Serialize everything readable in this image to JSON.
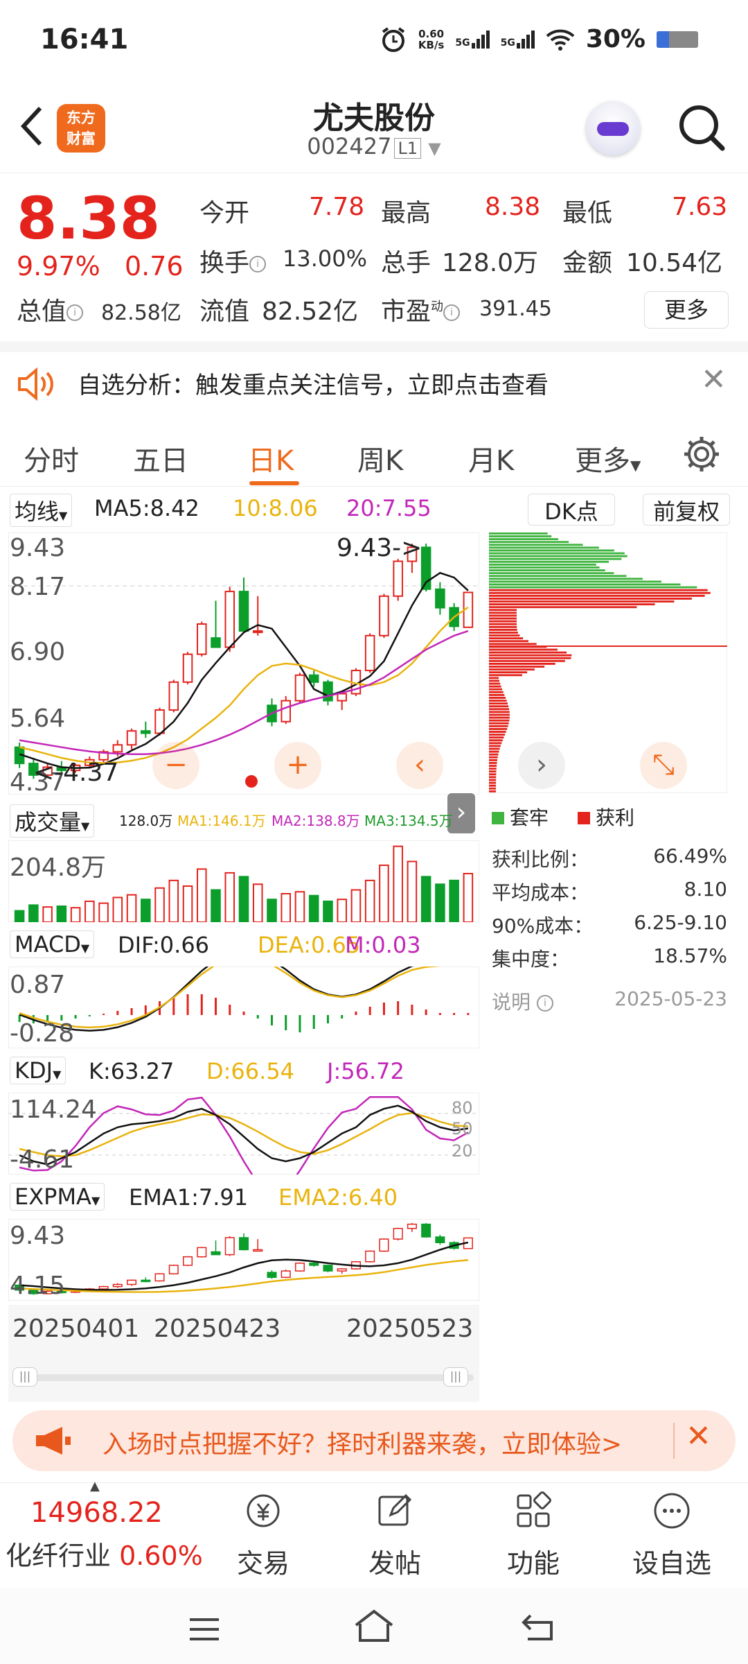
{
  "status_bar": {
    "time": "16:41",
    "net_speed": "0.60",
    "net_unit": "KB/s",
    "sig1": "5G",
    "sig2": "5G",
    "battery": "30%",
    "battery_level": 0.3
  },
  "header": {
    "logo_line1": "东方",
    "logo_line2": "财富",
    "title": "尤夫股份",
    "code": "002427",
    "level": "L1"
  },
  "quote": {
    "price": "8.38",
    "change_pct": "9.97%",
    "change": "0.76",
    "open_label": "今开",
    "open": "7.78",
    "high_label": "最高",
    "high": "8.38",
    "low_label": "最低",
    "low": "7.63",
    "turnover_label": "换手",
    "turnover": "13.00%",
    "volume_label": "总手",
    "volume": "128.0万",
    "amount_label": "金额",
    "amount": "10.54亿",
    "mktcap_label": "总值",
    "mktcap": "82.58亿",
    "float_label": "流值",
    "float_cap": "82.52亿",
    "pe_label": "市盈",
    "pe_sup": "动",
    "pe": "391.45",
    "more_label": "更多"
  },
  "notice": {
    "text": "自选分析：触发重点关注信号，立即点击查看"
  },
  "tabs": [
    "分时",
    "五日",
    "日K",
    "周K",
    "月K",
    "更多"
  ],
  "active_tab": 2,
  "chart": {
    "ma_selector": "均线",
    "ma5": "MA5:8.42",
    "ma10": "10:8.06",
    "ma20": "20:7.55",
    "dk_label": "DK点",
    "adj_label": "前复权",
    "y_labels": [
      "9.43",
      "8.17",
      "6.90",
      "5.64",
      "4.37"
    ],
    "high_marker": "9.43->",
    "low_marker": "<-4.37",
    "vol_selector": "成交量",
    "vol_now": "128.0万",
    "vol_ma1": "MA1:146.1万",
    "vol_ma2": "MA2:138.8万",
    "vol_ma3": "MA3:134.5万",
    "vol_axis": "204.8万",
    "macd_selector": "MACD",
    "dif": "DIF:0.66",
    "dea": "DEA:0.65",
    "m": "M:0.03",
    "macd_top": "0.87",
    "macd_bot": "-0.28",
    "kdj_selector": "KDJ",
    "k": "K:63.27",
    "d": "D:66.54",
    "j": "J:56.72",
    "kdj_top": "114.24",
    "kdj_bot": "-4.61",
    "kdj_80": "80",
    "kdj_50": "50",
    "kdj_20": "20",
    "expma_selector": "EXPMA",
    "ema1": "EMA1:7.91",
    "ema2": "EMA2:6.40",
    "expma_top": "9.43",
    "expma_bot": "4.15",
    "dates": [
      "20250401",
      "20250423",
      "20250523"
    ]
  },
  "chart_data": {
    "type": "candlestick",
    "title": "尤夫股份 002427 日K",
    "dates": [
      "20250401",
      "20250423",
      "20250523"
    ],
    "ylim": [
      4.37,
      9.43
    ],
    "candles": [
      {
        "o": 5.05,
        "h": 5.15,
        "l": 4.6,
        "c": 4.7
      },
      {
        "o": 4.7,
        "h": 4.8,
        "l": 4.37,
        "c": 4.45
      },
      {
        "o": 4.45,
        "h": 4.7,
        "l": 4.4,
        "c": 4.62
      },
      {
        "o": 4.62,
        "h": 4.75,
        "l": 4.45,
        "c": 4.55
      },
      {
        "o": 4.55,
        "h": 4.7,
        "l": 4.5,
        "c": 4.66
      },
      {
        "o": 4.66,
        "h": 4.85,
        "l": 4.6,
        "c": 4.78
      },
      {
        "o": 4.78,
        "h": 5.0,
        "l": 4.7,
        "c": 4.95
      },
      {
        "o": 4.95,
        "h": 5.2,
        "l": 4.85,
        "c": 5.1
      },
      {
        "o": 5.1,
        "h": 5.45,
        "l": 5.0,
        "c": 5.4
      },
      {
        "o": 5.4,
        "h": 5.6,
        "l": 5.25,
        "c": 5.35
      },
      {
        "o": 5.35,
        "h": 5.9,
        "l": 5.3,
        "c": 5.85
      },
      {
        "o": 5.85,
        "h": 6.5,
        "l": 5.8,
        "c": 6.45
      },
      {
        "o": 6.45,
        "h": 7.1,
        "l": 6.4,
        "c": 7.05
      },
      {
        "o": 7.05,
        "h": 7.75,
        "l": 7.0,
        "c": 7.7
      },
      {
        "o": 7.4,
        "h": 8.2,
        "l": 7.3,
        "c": 7.2
      },
      {
        "o": 7.2,
        "h": 8.5,
        "l": 7.1,
        "c": 8.4
      },
      {
        "o": 8.4,
        "h": 8.7,
        "l": 7.5,
        "c": 7.55
      },
      {
        "o": 7.55,
        "h": 8.3,
        "l": 7.45,
        "c": 7.55
      },
      {
        "o": 5.95,
        "h": 6.1,
        "l": 5.5,
        "c": 5.6
      },
      {
        "o": 5.6,
        "h": 6.15,
        "l": 5.55,
        "c": 6.05
      },
      {
        "o": 6.05,
        "h": 6.65,
        "l": 6.0,
        "c": 6.6
      },
      {
        "o": 6.6,
        "h": 6.7,
        "l": 6.35,
        "c": 6.45
      },
      {
        "o": 6.45,
        "h": 6.5,
        "l": 5.95,
        "c": 6.05
      },
      {
        "o": 6.05,
        "h": 6.25,
        "l": 5.85,
        "c": 6.2
      },
      {
        "o": 6.2,
        "h": 6.75,
        "l": 6.15,
        "c": 6.7
      },
      {
        "o": 6.7,
        "h": 7.5,
        "l": 6.65,
        "c": 7.45
      },
      {
        "o": 7.45,
        "h": 8.35,
        "l": 7.4,
        "c": 8.3
      },
      {
        "o": 8.3,
        "h": 9.1,
        "l": 8.2,
        "c": 9.05
      },
      {
        "o": 9.05,
        "h": 9.43,
        "l": 8.8,
        "c": 9.35
      },
      {
        "o": 9.35,
        "h": 9.43,
        "l": 8.4,
        "c": 8.45
      },
      {
        "o": 8.45,
        "h": 8.6,
        "l": 7.9,
        "c": 8.05
      },
      {
        "o": 8.05,
        "h": 8.15,
        "l": 7.55,
        "c": 7.65
      },
      {
        "o": 7.63,
        "h": 8.38,
        "l": 7.63,
        "c": 8.38
      }
    ],
    "ma5": [
      4.9,
      4.8,
      4.7,
      4.62,
      4.6,
      4.61,
      4.69,
      4.81,
      4.98,
      5.12,
      5.33,
      5.6,
      6.0,
      6.5,
      6.86,
      7.2,
      7.52,
      7.68,
      7.6,
      7.2,
      6.8,
      6.3,
      6.15,
      6.25,
      6.4,
      6.58,
      6.9,
      7.5,
      8.1,
      8.6,
      8.8,
      8.7,
      8.42
    ],
    "ma10": [
      5.05,
      4.98,
      4.9,
      4.82,
      4.76,
      4.72,
      4.71,
      4.72,
      4.76,
      4.82,
      4.92,
      5.05,
      5.22,
      5.45,
      5.68,
      5.95,
      6.3,
      6.6,
      6.8,
      6.85,
      6.82,
      6.72,
      6.6,
      6.5,
      6.42,
      6.38,
      6.45,
      6.6,
      6.85,
      7.2,
      7.55,
      7.85,
      8.06
    ],
    "ma20": [
      5.2,
      5.15,
      5.1,
      5.05,
      5.0,
      4.96,
      4.93,
      4.91,
      4.9,
      4.9,
      4.92,
      4.96,
      5.02,
      5.1,
      5.2,
      5.32,
      5.46,
      5.62,
      5.78,
      5.9,
      6.0,
      6.08,
      6.15,
      6.22,
      6.3,
      6.4,
      6.55,
      6.75,
      6.95,
      7.15,
      7.3,
      7.45,
      7.55
    ],
    "volume": [
      30,
      45,
      40,
      42,
      38,
      55,
      50,
      65,
      72,
      60,
      90,
      110,
      95,
      140,
      85,
      130,
      120,
      100,
      60,
      75,
      80,
      70,
      55,
      60,
      85,
      110,
      150,
      200,
      160,
      120,
      100,
      110,
      128
    ],
    "macd_hist": [
      -0.1,
      -0.12,
      -0.1,
      -0.08,
      -0.05,
      -0.02,
      0.02,
      0.06,
      0.1,
      0.14,
      0.2,
      0.25,
      0.3,
      0.3,
      0.25,
      0.15,
      0.05,
      -0.05,
      -0.15,
      -0.22,
      -0.25,
      -0.2,
      -0.12,
      -0.05,
      0.05,
      0.12,
      0.18,
      0.2,
      0.15,
      0.08,
      0.03,
      0.03,
      0.03
    ],
    "kdj_k": [
      20,
      10,
      5,
      15,
      25,
      40,
      55,
      65,
      70,
      72,
      75,
      80,
      90,
      95,
      85,
      70,
      50,
      30,
      15,
      10,
      15,
      25,
      40,
      55,
      65,
      85,
      95,
      100,
      90,
      75,
      65,
      60,
      63.27
    ],
    "kdj_d": [
      30,
      25,
      20,
      18,
      20,
      28,
      38,
      48,
      58,
      65,
      70,
      74,
      80,
      86,
      85,
      80,
      70,
      58,
      45,
      33,
      25,
      22,
      28,
      38,
      50,
      62,
      75,
      85,
      88,
      82,
      74,
      68,
      66.54
    ],
    "kdj_j": [
      0,
      -5,
      -4,
      10,
      35,
      65,
      88,
      99,
      94,
      86,
      85,
      92,
      110,
      113,
      85,
      50,
      10,
      -26,
      -45,
      -36,
      -5,
      31,
      64,
      89,
      95,
      114,
      114,
      114,
      94,
      61,
      47,
      44,
      56.72
    ],
    "chip_profit_ratio": "66.49%"
  },
  "chips": {
    "legend_hold": "套牢",
    "legend_profit": "获利",
    "profit_ratio_label": "获利比例：",
    "profit_ratio": "66.49%",
    "avg_cost_label": "平均成本：",
    "avg_cost": "8.10",
    "cost90_label": "90%成本：",
    "cost90": "6.25-9.10",
    "concentration_label": "集中度：",
    "concentration": "18.57%",
    "note_label": "说明",
    "date": "2025-05-23"
  },
  "promo": {
    "text": "入场时点把握不好？择时利器来袭，立即体验>"
  },
  "bottom": {
    "index_value": "14968.22",
    "index_name": "化纤行业",
    "index_chg": "0.60%",
    "trade": "交易",
    "post": "发帖",
    "func": "功能",
    "watch": "设自选"
  },
  "colors": {
    "up": "#e3231c",
    "down": "#0b9e2b",
    "accent": "#f06a1e",
    "ma5": "#111111",
    "ma10": "#e9b30c",
    "ma20": "#c226b8"
  }
}
